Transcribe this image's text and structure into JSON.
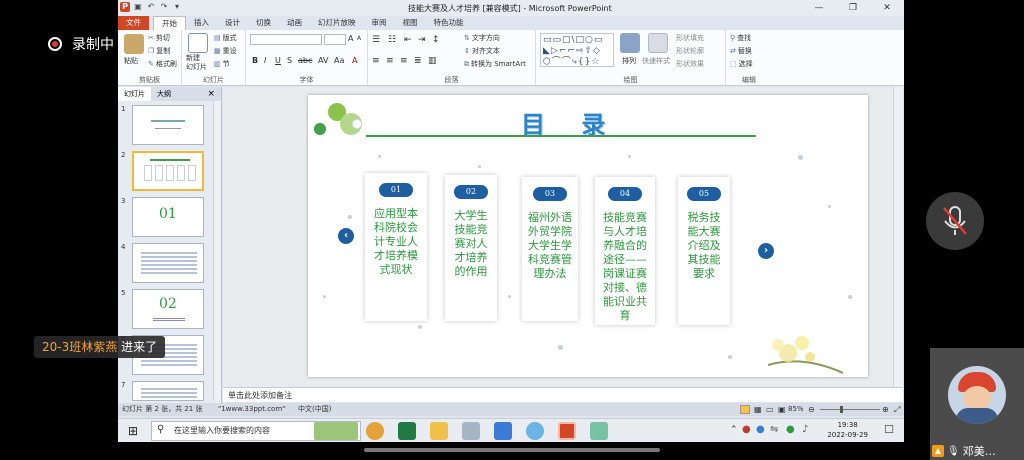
{
  "overlay": {
    "record_label": "录制中",
    "join_name": "20-3班林紫燕",
    "join_action": "进来了",
    "cam_name": "邓美…"
  },
  "window": {
    "title": "技能大赛及人才培养 [兼容模式] - Microsoft PowerPoint",
    "tabs": [
      "文件",
      "开始",
      "插入",
      "设计",
      "切换",
      "动画",
      "幻灯片放映",
      "审阅",
      "视图",
      "特色功能"
    ],
    "active_tab": "开始"
  },
  "ribbon": {
    "clipboard": {
      "paste": "粘贴",
      "cut": "剪切",
      "copy": "复制",
      "format_painter": "格式刷",
      "group": "剪贴板"
    },
    "slides": {
      "new_slide": "新建\n幻灯片",
      "layout": "版式",
      "reset": "重设",
      "section": "节",
      "group": "幻灯片"
    },
    "font": {
      "group": "字体"
    },
    "paragraph": {
      "text_direction": "文字方向",
      "align_text": "对齐文本",
      "smartart": "转换为 SmartArt",
      "group": "段落"
    },
    "drawing": {
      "arrange": "排列",
      "quick_styles": "快速样式",
      "shape_fill": "形状填充",
      "shape_outline": "形状轮廓",
      "shape_effects": "形状效果",
      "group": "绘图"
    },
    "editing": {
      "find": "查找",
      "replace": "替换",
      "select": "选择",
      "group": "编辑"
    }
  },
  "panel": {
    "tab_slides": "幻灯片",
    "tab_outline": "大纲",
    "close": "×",
    "thumbs": [
      {
        "num": "1",
        "text": ""
      },
      {
        "num": "2",
        "text": ""
      },
      {
        "num": "3",
        "text": "01"
      },
      {
        "num": "4",
        "text": ""
      },
      {
        "num": "5",
        "text": "02"
      },
      {
        "num": "6",
        "text": ""
      },
      {
        "num": "7",
        "text": ""
      }
    ]
  },
  "slide": {
    "title": "目 录",
    "items": [
      {
        "num": "01",
        "text": "应用型本科院校会计专业人才培养模式现状"
      },
      {
        "num": "02",
        "text": "大学生技能竞赛对人才培养的作用"
      },
      {
        "num": "03",
        "text": "福州外语外贸学院大学生学科竞赛管理办法"
      },
      {
        "num": "04",
        "text": "技能竞赛与人才培养融合的途径——岗课证赛对接、德能识业共育"
      },
      {
        "num": "05",
        "text": "税务技能大赛介绍及其技能要求"
      }
    ],
    "prev_arrow": "‹",
    "next_arrow": "›"
  },
  "notes_placeholder": "单击此处添加备注",
  "status": {
    "slide_info": "幻灯片 第 2 张，共 21 张",
    "theme": "\"1www.33ppt.com\"",
    "language": "中文(中国)",
    "zoom": "85%"
  },
  "taskbar": {
    "search_placeholder": "在这里输入你要搜索的内容",
    "time": "19:38",
    "date": "2022-09-29"
  },
  "colors": {
    "accent_blue": "#1d5fa0",
    "text_green": "#2a9a3b",
    "title_blue": "#2e82c9",
    "file_tab": "#d24726"
  }
}
